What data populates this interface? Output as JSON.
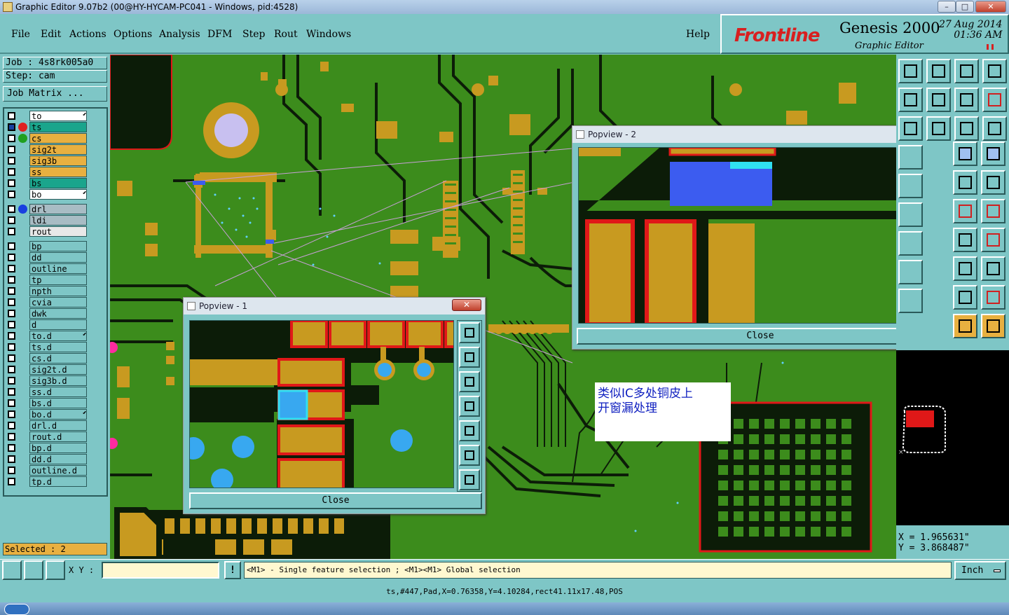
{
  "window": {
    "title": "Graphic Editor 9.07b2 (00@HY-HYCAM-PC041 - Windows, pid:4528)"
  },
  "menu": [
    "File",
    "Edit",
    "Actions",
    "Options",
    "Analysis",
    "DFM",
    "Step",
    "Rout",
    "Windows"
  ],
  "help": "Help",
  "logo": {
    "brand": "Frontline",
    "product": "Genesis 2000",
    "subtitle": "Graphic Editor",
    "date": "27 Aug 2014",
    "time": "01:36 AM"
  },
  "job": {
    "job": "Job : 4s8rk005a0",
    "step": "Step: cam",
    "matrix_button": "Job Matrix ..."
  },
  "layers": [
    {
      "name": "to",
      "color": "#ffffff",
      "mark": true
    },
    {
      "name": "ts",
      "color": "#1aa58c",
      "dot": "#e02020",
      "mark": false,
      "active": true
    },
    {
      "name": "cs",
      "color": "#e8b040",
      "dot": "#20a020"
    },
    {
      "name": "sig2t",
      "color": "#e8b040"
    },
    {
      "name": "sig3b",
      "color": "#e8b040"
    },
    {
      "name": "ss",
      "color": "#e8b040"
    },
    {
      "name": "bs",
      "color": "#1aa58c"
    },
    {
      "name": "bo",
      "color": "#ffffff",
      "mark": true
    },
    {
      "name": "drl",
      "color": "#a8bcc4",
      "dot": "#1840e0"
    },
    {
      "name": "ldi",
      "color": "#a8bcc4"
    },
    {
      "name": "rout",
      "color": "#e8e8e8"
    },
    {
      "name": "bp",
      "color": "#7ec6c6"
    },
    {
      "name": "dd",
      "color": "#7ec6c6"
    },
    {
      "name": "outline",
      "color": "#7ec6c6"
    },
    {
      "name": "tp",
      "color": "#7ec6c6"
    },
    {
      "name": "npth",
      "color": "#7ec6c6"
    },
    {
      "name": "cvia",
      "color": "#7ec6c6"
    },
    {
      "name": "dwk",
      "color": "#7ec6c6"
    },
    {
      "name": "d",
      "color": "#7ec6c6"
    },
    {
      "name": "to.d",
      "color": "#7ec6c6",
      "mark": true
    },
    {
      "name": "ts.d",
      "color": "#7ec6c6"
    },
    {
      "name": "cs.d",
      "color": "#7ec6c6"
    },
    {
      "name": "sig2t.d",
      "color": "#7ec6c6"
    },
    {
      "name": "sig3b.d",
      "color": "#7ec6c6"
    },
    {
      "name": "ss.d",
      "color": "#7ec6c6"
    },
    {
      "name": "bs.d",
      "color": "#7ec6c6"
    },
    {
      "name": "bo.d",
      "color": "#7ec6c6",
      "mark": true
    },
    {
      "name": "drl.d",
      "color": "#7ec6c6"
    },
    {
      "name": "rout.d",
      "color": "#7ec6c6"
    },
    {
      "name": "bp.d",
      "color": "#7ec6c6"
    },
    {
      "name": "dd.d",
      "color": "#7ec6c6"
    },
    {
      "name": "outline.d",
      "color": "#7ec6c6"
    },
    {
      "name": "tp.d",
      "color": "#7ec6c6"
    }
  ],
  "selected": "Selected : 2",
  "popview1": {
    "title": "Popview - 1",
    "close": "Close"
  },
  "popview2": {
    "title": "Popview - 2",
    "close": "Close"
  },
  "note": {
    "line1": "类似IC多处铜皮上",
    "line2": "开窗漏处理"
  },
  "coords": {
    "x": "X = 1.965631\"",
    "y": "Y = 3.868487\""
  },
  "bottom": {
    "xy_label": "X Y :",
    "xy_value": "",
    "hint": "<M1> - Single feature selection ; <M1><M1> Global selection",
    "units": "Inch"
  },
  "status": "ts,#447,Pad,X=0.76358,Y=4.10284,rect41.11x17.48,POS",
  "colors": {
    "board": "#3c8c1c",
    "copper": "#c89a20",
    "mask": "#e01818",
    "trace": "#0c1c08",
    "bg": "#7ec6c6",
    "hole": "#38a8f0"
  }
}
